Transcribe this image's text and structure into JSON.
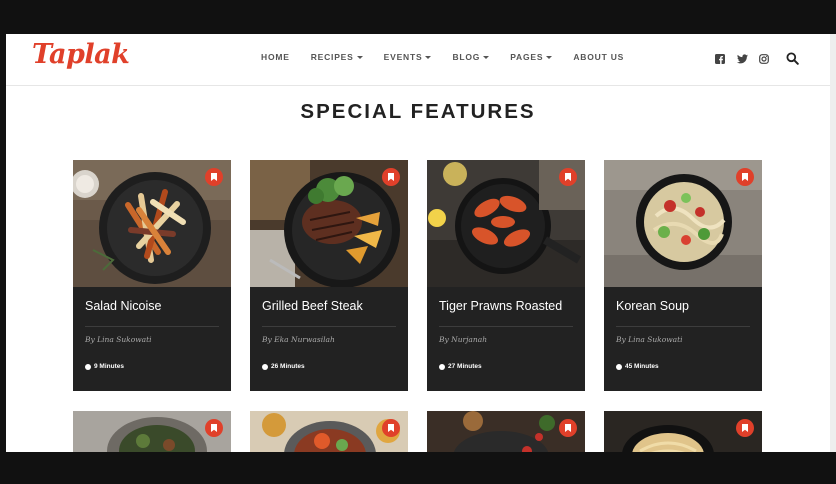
{
  "brand": {
    "logo": "Taplak",
    "accent": "#e0402a"
  },
  "nav": {
    "items": [
      {
        "label": "HOME",
        "dropdown": false
      },
      {
        "label": "RECIPES",
        "dropdown": true
      },
      {
        "label": "EVENTS",
        "dropdown": true
      },
      {
        "label": "BLOG",
        "dropdown": true
      },
      {
        "label": "PAGES",
        "dropdown": true
      },
      {
        "label": "ABOUT US",
        "dropdown": false
      }
    ],
    "social": [
      "facebook-icon",
      "twitter-icon",
      "instagram-icon"
    ],
    "search_icon": "search-icon"
  },
  "section": {
    "title": "SPECIAL FEATURES"
  },
  "recipes": [
    {
      "name": "Salad Nicoise",
      "author": "By Lina Sukowati",
      "time": "9 Minutes"
    },
    {
      "name": "Grilled Beef Steak",
      "author": "By Eka Nurwasilah",
      "time": "26 Minutes"
    },
    {
      "name": "Tiger Prawns Roasted",
      "author": "By Nurjanah",
      "time": "27 Minutes"
    },
    {
      "name": "Korean Soup",
      "author": "By Lina Sukowati",
      "time": "45 Minutes"
    }
  ]
}
